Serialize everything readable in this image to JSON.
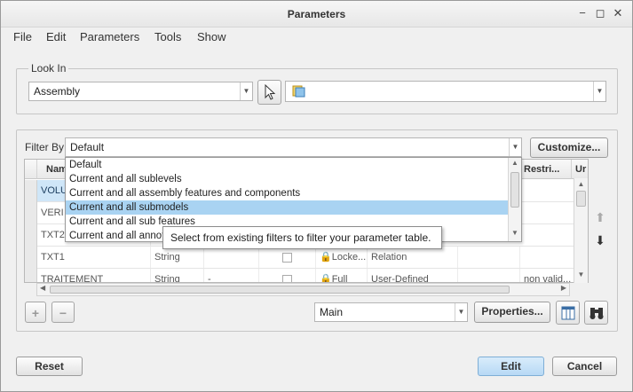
{
  "window": {
    "title": "Parameters",
    "minimize_icon": "minimize-icon",
    "maximize_icon": "maximize-icon",
    "close_icon": "close-icon",
    "minimize_glyph": "−",
    "maximize_glyph": "◻",
    "close_glyph": "✕"
  },
  "menu": [
    "File",
    "Edit",
    "Parameters",
    "Tools",
    "Show"
  ],
  "look_in": {
    "label": "Look In",
    "type_value": "Assembly",
    "model_value": ""
  },
  "filter": {
    "label": "Filter By",
    "value": "Default",
    "customize_label": "Customize..."
  },
  "filter_options": [
    "Default",
    "Current and all sublevels",
    "Current and all assembly features and components",
    "Current and all submodels",
    "Current and all sub features",
    "Current and all annota"
  ],
  "filter_selected_index": 3,
  "tooltip": "Select from existing filters to filter your parameter table.",
  "table": {
    "headers": {
      "name": "Nam",
      "restriction": "Restri...",
      "unit": "Ur"
    },
    "rows": [
      {
        "name": "VOLU",
        "type": "",
        "value": "",
        "access": "",
        "source": "",
        "restriction": ""
      },
      {
        "name": "VERI",
        "type": "",
        "value": "",
        "access": "",
        "source": "",
        "restriction": ""
      },
      {
        "name": "TXT2",
        "type": "",
        "value": "",
        "access": "",
        "source": "",
        "restriction": ""
      },
      {
        "name": "TXT1",
        "type": "String",
        "value": "",
        "access": "Locke...",
        "source": "Relation",
        "restriction": ""
      },
      {
        "name": "TRAITEMENT",
        "type": "String",
        "value": "-",
        "access": "Full",
        "source": "User-Defined",
        "restriction": "non valid..."
      }
    ]
  },
  "bottom": {
    "main_value": "Main",
    "properties_label": "Properties...",
    "add_glyph": "+",
    "remove_glyph": "−",
    "up_glyph": "⬆",
    "down_glyph": "⬇"
  },
  "footer": {
    "reset_label": "Reset",
    "edit_label": "Edit",
    "cancel_label": "Cancel"
  },
  "colors": {
    "selected_row": "#a9d3f2",
    "highlight_cell": "#cfe6f8",
    "primary_button": "#b7d9f5"
  }
}
